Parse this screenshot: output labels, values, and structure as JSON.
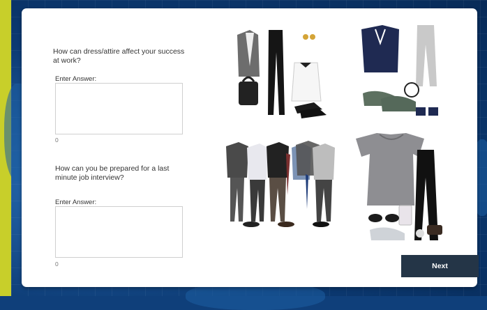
{
  "questions": [
    {
      "prompt": "How can dress/attire affect your success at work?",
      "answer_label": "Enter Answer:",
      "answer_value": "",
      "char_count": "0"
    },
    {
      "prompt": "How can you be prepared for a last minute job interview?",
      "answer_label": "Enter Answer:",
      "answer_value": "",
      "char_count": "0"
    }
  ],
  "next_label": "Next",
  "images": [
    {
      "name": "business-casual-outfit-image",
      "icon": "outfit-blazer-trousers-bag-shoes"
    },
    {
      "name": "athletic-outfit-image",
      "icon": "outfit-vest-joggers-sneakers-jumprope"
    },
    {
      "name": "mens-suits-image",
      "icon": "outfit-five-mens-suits"
    },
    {
      "name": "casual-outfit-image",
      "icon": "outfit-tshirt-leggings-sunglasses-sneakers"
    }
  ],
  "colors": {
    "accent_left": "#c8cf2a",
    "background": "#0f3f7a",
    "next_button": "#243547"
  }
}
